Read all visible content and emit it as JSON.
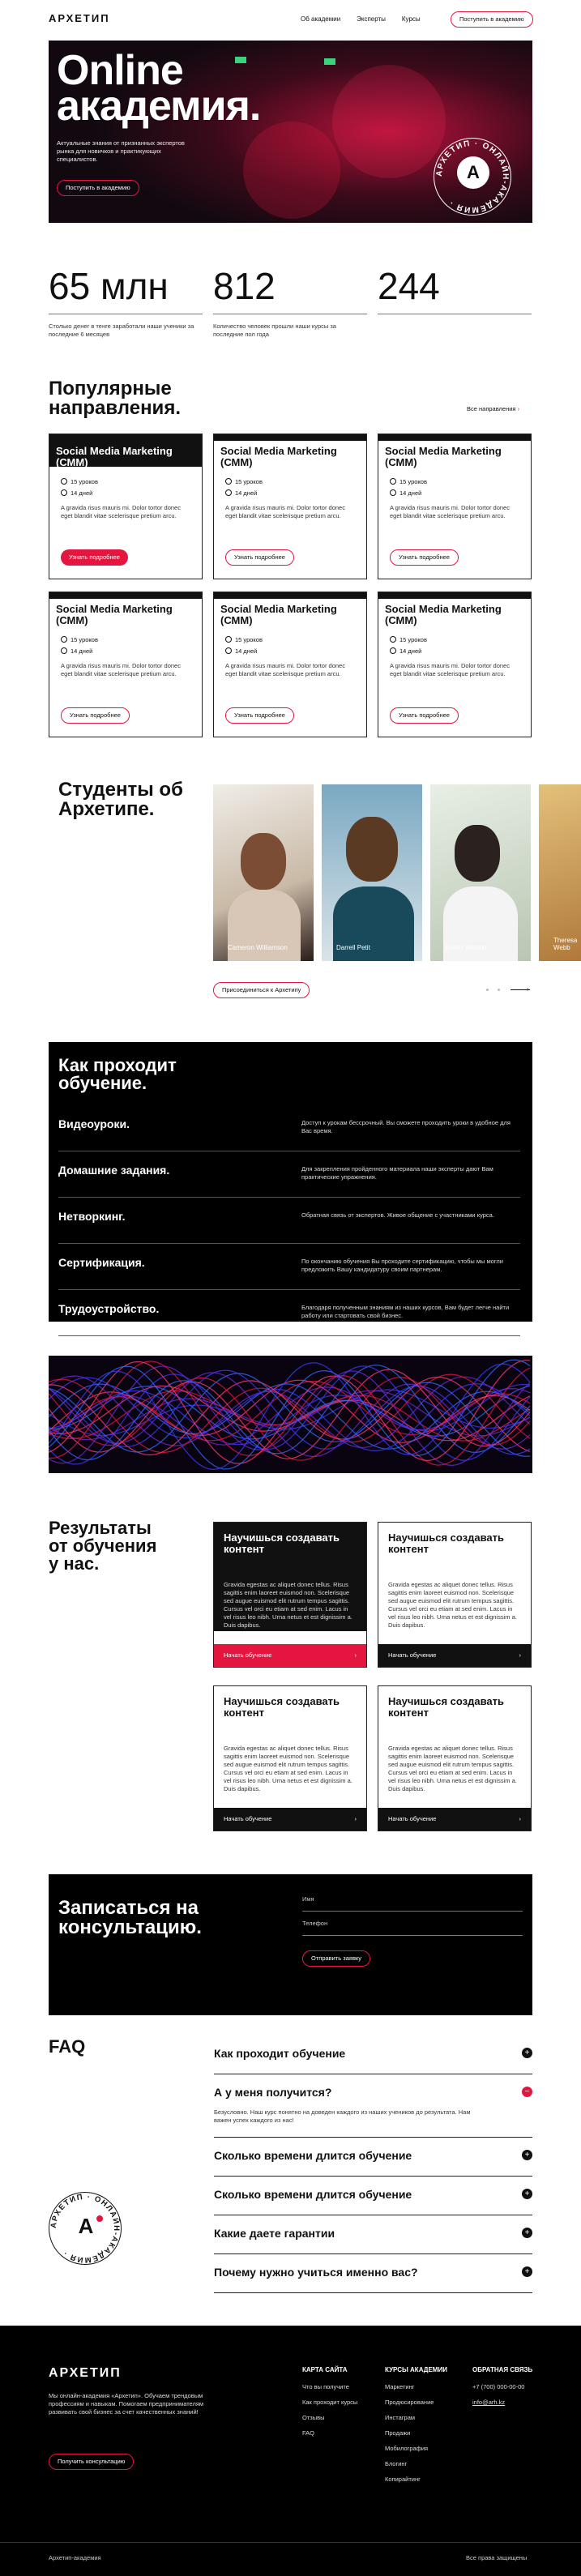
{
  "header": {
    "logo": "АРХЕТИП",
    "nav": [
      "Об академии",
      "Эксперты",
      "Курсы"
    ],
    "cta": "Поступить в академию"
  },
  "hero": {
    "title_l1": "Online",
    "title_l2": "академия.",
    "subtitle": "Актуальные знания от признанных экспертов рынка для новичков и практикующих специалистов.",
    "button": "Поступить в академию",
    "badge_letter": "A",
    "badge_ring": "АРХЕТИП · ОНЛАЙН-АКАДЕМИЯ ·"
  },
  "stats": [
    {
      "value": "65 млн",
      "text": "Столько денег в тенге заработали наши ученики за последние 6 месяцев"
    },
    {
      "value": "812",
      "text": "Количество человек прошли наши курсы за последние пол года"
    },
    {
      "value": "244",
      "text": ""
    }
  ],
  "courses": {
    "heading_l1": "Популярные",
    "heading_l2": "направления.",
    "all_link": "Все направления",
    "items": [
      {
        "title": "Social Media Marketing (СММ)",
        "lessons": "15 уроков",
        "days": "14 дней",
        "desc": "A gravida risus mauris mi. Dolor tortor donec eget blandit vitae scelerisque pretium arcu.",
        "button": "Узнать подробнее"
      },
      {
        "title": "Social Media Marketing (СММ)",
        "lessons": "15 уроков",
        "days": "14 дней",
        "desc": "A gravida risus mauris mi. Dolor tortor donec eget blandit vitae scelerisque pretium arcu.",
        "button": "Узнать подробнее"
      },
      {
        "title": "Social Media Marketing (СММ)",
        "lessons": "15 уроков",
        "days": "14 дней",
        "desc": "A gravida risus mauris mi. Dolor tortor donec eget blandit vitae scelerisque pretium arcu.",
        "button": "Узнать подробнее"
      },
      {
        "title": "Social Media Marketing (СММ)",
        "lessons": "15 уроков",
        "days": "14 дней",
        "desc": "A gravida risus mauris mi. Dolor tortor donec eget blandit vitae scelerisque pretium arcu.",
        "button": "Узнать подробнее"
      },
      {
        "title": "Social Media Marketing (СММ)",
        "lessons": "15 уроков",
        "days": "14 дней",
        "desc": "A gravida risus mauris mi. Dolor tortor donec eget blandit vitae scelerisque pretium arcu.",
        "button": "Узнать подробнее"
      },
      {
        "title": "Social Media Marketing (СММ)",
        "lessons": "15 уроков",
        "days": "14 дней",
        "desc": "A gravida risus mauris mi. Dolor tortor donec eget blandit vitae scelerisque pretium arcu.",
        "button": "Узнать подробнее"
      }
    ]
  },
  "students": {
    "heading_l1": "Студенты об",
    "heading_l2": "Архетипе.",
    "names": [
      "Cameron Williamson",
      "Darrell Petit",
      "Kristin Watson",
      "Theresa Webb"
    ],
    "button": "Присоединиться к Архетипу"
  },
  "learning": {
    "heading_l1": "Как проходит",
    "heading_l2": "обучение.",
    "rows": [
      {
        "title": "Видеоуроки.",
        "text": "Доступ к урокам бессрочный. Вы сможете проходить уроки в удобное для Вас время."
      },
      {
        "title": "Домашние задания.",
        "text": "Для закрепления пройденного материала наши эксперты дают Вам практические упражнения."
      },
      {
        "title": "Нетворкинг.",
        "text": "Обратная связь от экспертов. Живое общение с участниками курса."
      },
      {
        "title": "Сертификация.",
        "text": "По окончанию обучения Вы проходите сертификацию, чтобы мы могли предложить Вашу кандидатуру своим партнерам."
      },
      {
        "title": "Трудоустройство.",
        "text": "Благодаря полученным знаниям из наших курсов, Вам будет легче найти работу или стартовать свой бизнес."
      }
    ]
  },
  "results": {
    "heading_l1": "Результаты",
    "heading_l2": "от обучения",
    "heading_l3": "у нас.",
    "items": [
      {
        "title": "Научишься создавать контент",
        "text": "Gravida egestas ac aliquet donec tellus. Risus sagittis enim laoreet euismod non. Scelerisque sed augue euismod elit rutrum tempus sagittis. Cursus vel orci eu etiam at sed enim. Lacus in vel risus leo nibh. Urna netus et est dignissim a. Duis dapibus.",
        "button": "Начать обучение"
      },
      {
        "title": "Научишься создавать контент",
        "text": "Gravida egestas ac aliquet donec tellus. Risus sagittis enim laoreet euismod non. Scelerisque sed augue euismod elit rutrum tempus sagittis. Cursus vel orci eu etiam at sed enim. Lacus in vel risus leo nibh. Urna netus et est dignissim a. Duis dapibus.",
        "button": "Начать обучение"
      },
      {
        "title": "Научишься создавать контент",
        "text": "Gravida egestas ac aliquet donec tellus. Risus sagittis enim laoreet euismod non. Scelerisque sed augue euismod elit rutrum tempus sagittis. Cursus vel orci eu etiam at sed enim. Lacus in vel risus leo nibh. Urna netus et est dignissim a. Duis dapibus.",
        "button": "Начать обучение"
      },
      {
        "title": "Научишься создавать контент",
        "text": "Gravida egestas ac aliquet donec tellus. Risus sagittis enim laoreet euismod non. Scelerisque sed augue euismod elit rutrum tempus sagittis. Cursus vel orci eu etiam at sed enim. Lacus in vel risus leo nibh. Urna netus et est dignissim a. Duis dapibus.",
        "button": "Начать обучение"
      }
    ]
  },
  "consult": {
    "heading_l1": "Записаться на",
    "heading_l2": "консультацию.",
    "name_placeholder": "Имя",
    "phone_placeholder": "Телефон",
    "button": "Отправить заявку"
  },
  "faq": {
    "heading": "FAQ",
    "open_answer": "Безусловно. Наш курс понятно на доведен каждого из наших учеников до результата. Нам важен успех каждого из нас!",
    "items": [
      "Как проходит обучение",
      "А у меня получится?",
      "Сколько времени длится обучение",
      "Сколько времени длится обучение",
      "Какие даете гарантии",
      "Почему нужно учиться именно вас?"
    ]
  },
  "footer": {
    "logo": "АРХЕТИП",
    "about": "Мы онлайн-академия «Архетип». Обучаем трендовым профессиям и навыкам. Помогаем предпринимателям развивать свой бизнес за счет качественных знаний!",
    "button": "Получить консультацию",
    "col1_h": "КАРТА САЙТА",
    "col1": [
      "Что вы получите",
      "Как проходит курсы",
      "Отзывы",
      "FAQ"
    ],
    "col2_h": "КУРСЫ АКАДЕМИИ",
    "col2": [
      "Маркетинг",
      "Продюсирование",
      "Инстаграм",
      "Продажи",
      "Мобилография",
      "Блогинг",
      "Копирайтинг"
    ],
    "col3_h": "ОБРАТНАЯ СВЯЗЬ",
    "phone": "+7 (700) 000-00-00",
    "email": "info@arh.kz",
    "copy": "Архетип-академия",
    "rights": "Все права защищены"
  },
  "colors": {
    "accent": "#e4163f",
    "dark": "#000000"
  }
}
